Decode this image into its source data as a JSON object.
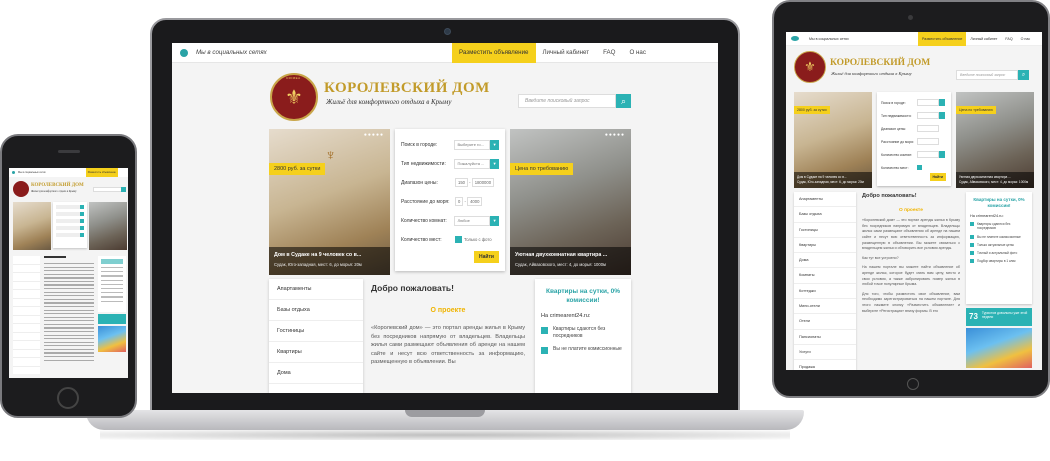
{
  "site": {
    "social_label": "Мы в социальных сетях",
    "nav": [
      "Разместить объявление",
      "Личный кабинет",
      "FAQ",
      "О нас"
    ],
    "brand": "КОРОЛЕВСКИЙ ДОМ",
    "brand_short": "КОРОЛЕВСКИЙ ДОМ",
    "tagline": "Жильё для комфортного отдыха в Крыму",
    "logo_top": "CRIMEA",
    "logo_bottom": "RENTER",
    "search_placeholder": "Введите поисковый запрос"
  },
  "listings": [
    {
      "price": "2800 руб. за сутки",
      "title": "Дом в Судаке на 9 человек со в...",
      "location": "Судак, Юго-западная, мест: 6, до морья: 20м"
    },
    {
      "price": "Цена по требованию",
      "title": "Уютная двухкомнатная квартира ...",
      "location": "Судак, Айвазовского, мест: 4, до морья: 1000м"
    }
  ],
  "search_form": {
    "city_label": "Поиск в городе:",
    "city_value": "Выберите го...",
    "type_label": "Тип недвижимости:",
    "type_value": "Пожалуйста ...",
    "price_label": "Диапазон цены:",
    "price_from": "150",
    "price_to": "1800000",
    "sea_label": "Расстояние до моря:",
    "sea_from": "0",
    "sea_to": "4000",
    "rooms_label": "Количество комнат:",
    "rooms_value": "Любое",
    "places_label": "Количество мест:",
    "photo_label": "Только с фото",
    "find_button": "Найти"
  },
  "sidebar": [
    "Апартаменты",
    "Базы отдыха",
    "Гостиницы",
    "Квартиры",
    "Дома",
    "Комнаты",
    "Коттеджи",
    "Мини-отели",
    "Отели",
    "Пансионаты",
    "Услуги",
    "Продажа"
  ],
  "main": {
    "welcome": "Добро пожаловать!",
    "about_title": "О проекте",
    "about_text": "«Королевский дом» — это портал аренды жилья в Крыму без посредников напрямую от владельцев. Владельцы жилья сами размещают объявления об аренде на нашем сайте и несут всю ответственность за информацию, размещенную в объявлении. Вы",
    "tablet_para1": "«Королевский дом» — это портал аренды жилья в Крыму без посредников напрямую от владельцев. Владельцы жилья сами размещают объявления об аренде на нашем сайте и несут всю ответственность за информацию, размещенную в объявлении. Вы можете связаться с владельцем жилья и обговорить все условия аренды.",
    "tablet_q": "Как тут все устроено?",
    "tablet_para2": "На нашем портале вы можете найти объявление об аренде жилья, которое будет знать вам цену, место и свои условия, а также забронировать номер жилья в любой точке популярные Крыма.",
    "tablet_para3": "Для того, чтобы разместить свое объявление, вам необходимо зарегистрироваться на нашем портале. Для этого нажмите кнопку «Разместить объявление» и выберите «Регистрация» внизу формы. В его"
  },
  "promo": {
    "title": "Квартиры на сутки, 0% комиссии!",
    "site": "На crimearent24.ru:",
    "items": [
      "Квартиры сдаются без посредников",
      "Вы не платите комиссионные"
    ],
    "tablet_items": [
      "Квартиры сдаются без посредников",
      "Вы не платите комиссионные",
      "Только актуальные цены",
      "Точный и актуальный фото",
      "Подбор квартиры в 1 клик"
    ],
    "badge_number": "73",
    "badge_text": "Туристов довольны уже этой недели"
  }
}
